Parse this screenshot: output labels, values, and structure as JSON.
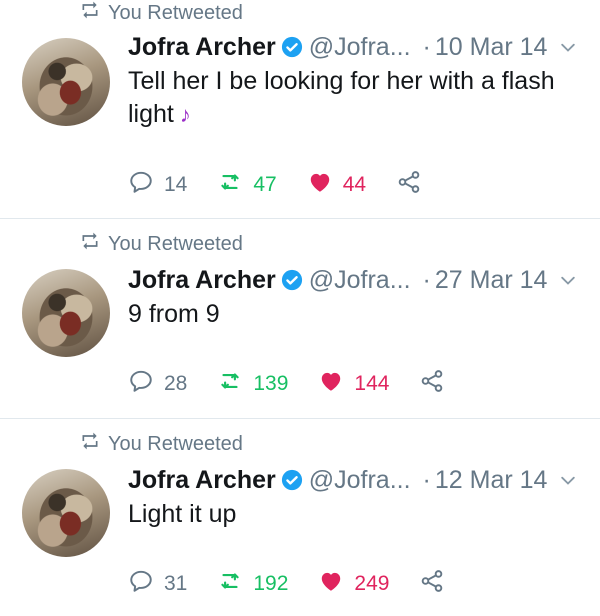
{
  "tweets": [
    {
      "retweet_label": "You Retweeted",
      "name": "Jofra Archer",
      "handle": "@Jofra...",
      "date": "10 Mar 14",
      "text": "Tell her I be looking for her with a flash light",
      "emoji": "♪",
      "replies": "14",
      "retweets": "47",
      "likes": "44"
    },
    {
      "retweet_label": "You Retweeted",
      "name": "Jofra Archer",
      "handle": "@Jofra...",
      "date": "27 Mar 14",
      "text": "9 from 9",
      "replies": "28",
      "retweets": "139",
      "likes": "144"
    },
    {
      "retweet_label": "You Retweeted",
      "name": "Jofra Archer",
      "handle": "@Jofra...",
      "date": "12 Mar 14",
      "text": "Light it up",
      "replies": "31",
      "retweets": "192",
      "likes": "249"
    }
  ],
  "colors": {
    "retweet_green": "#17bf63",
    "like_red": "#e0245e",
    "verified_blue": "#1da1f2",
    "secondary_gray": "#657786"
  },
  "icons": [
    "retweet-icon",
    "verified-badge-icon",
    "chevron-down-icon",
    "reply-icon",
    "heart-icon",
    "share-icon",
    "music-note-icon"
  ]
}
